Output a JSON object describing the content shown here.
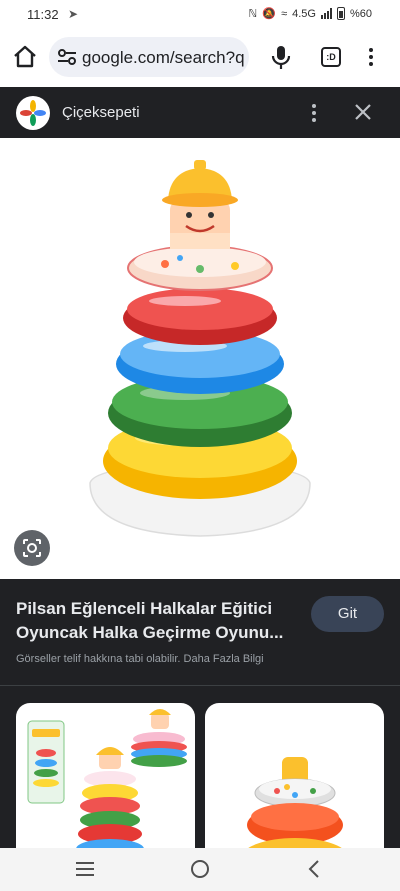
{
  "status_bar": {
    "time": "11:32",
    "network": "4.5G",
    "battery": "%60"
  },
  "browser": {
    "url": "google.com/search?q",
    "tab_count": ":D"
  },
  "viewer": {
    "source_name": "Çiçeksepeti"
  },
  "result": {
    "title_line1": "Pilsan Eğlenceli Halkalar Eğitici",
    "title_line2": "Oyuncak Halka Geçirme Oyunu...",
    "visit_button": "Git",
    "notice": "Görseller telif hakkına tabi olabilir. Daha Fazla Bilgi"
  },
  "icons": [
    "home-icon",
    "tune-icon",
    "microphone-icon",
    "tab-switcher-icon",
    "more-vert-icon",
    "close-icon",
    "google-lens-icon",
    "recents-icon",
    "home-circle-icon",
    "back-icon"
  ],
  "colors": {
    "dark_bg": "#202124",
    "go_button": "#394457",
    "ring_red": "#e53935",
    "ring_blue": "#42a5f5",
    "ring_green": "#43a047",
    "ring_yellow": "#fbc02d"
  }
}
